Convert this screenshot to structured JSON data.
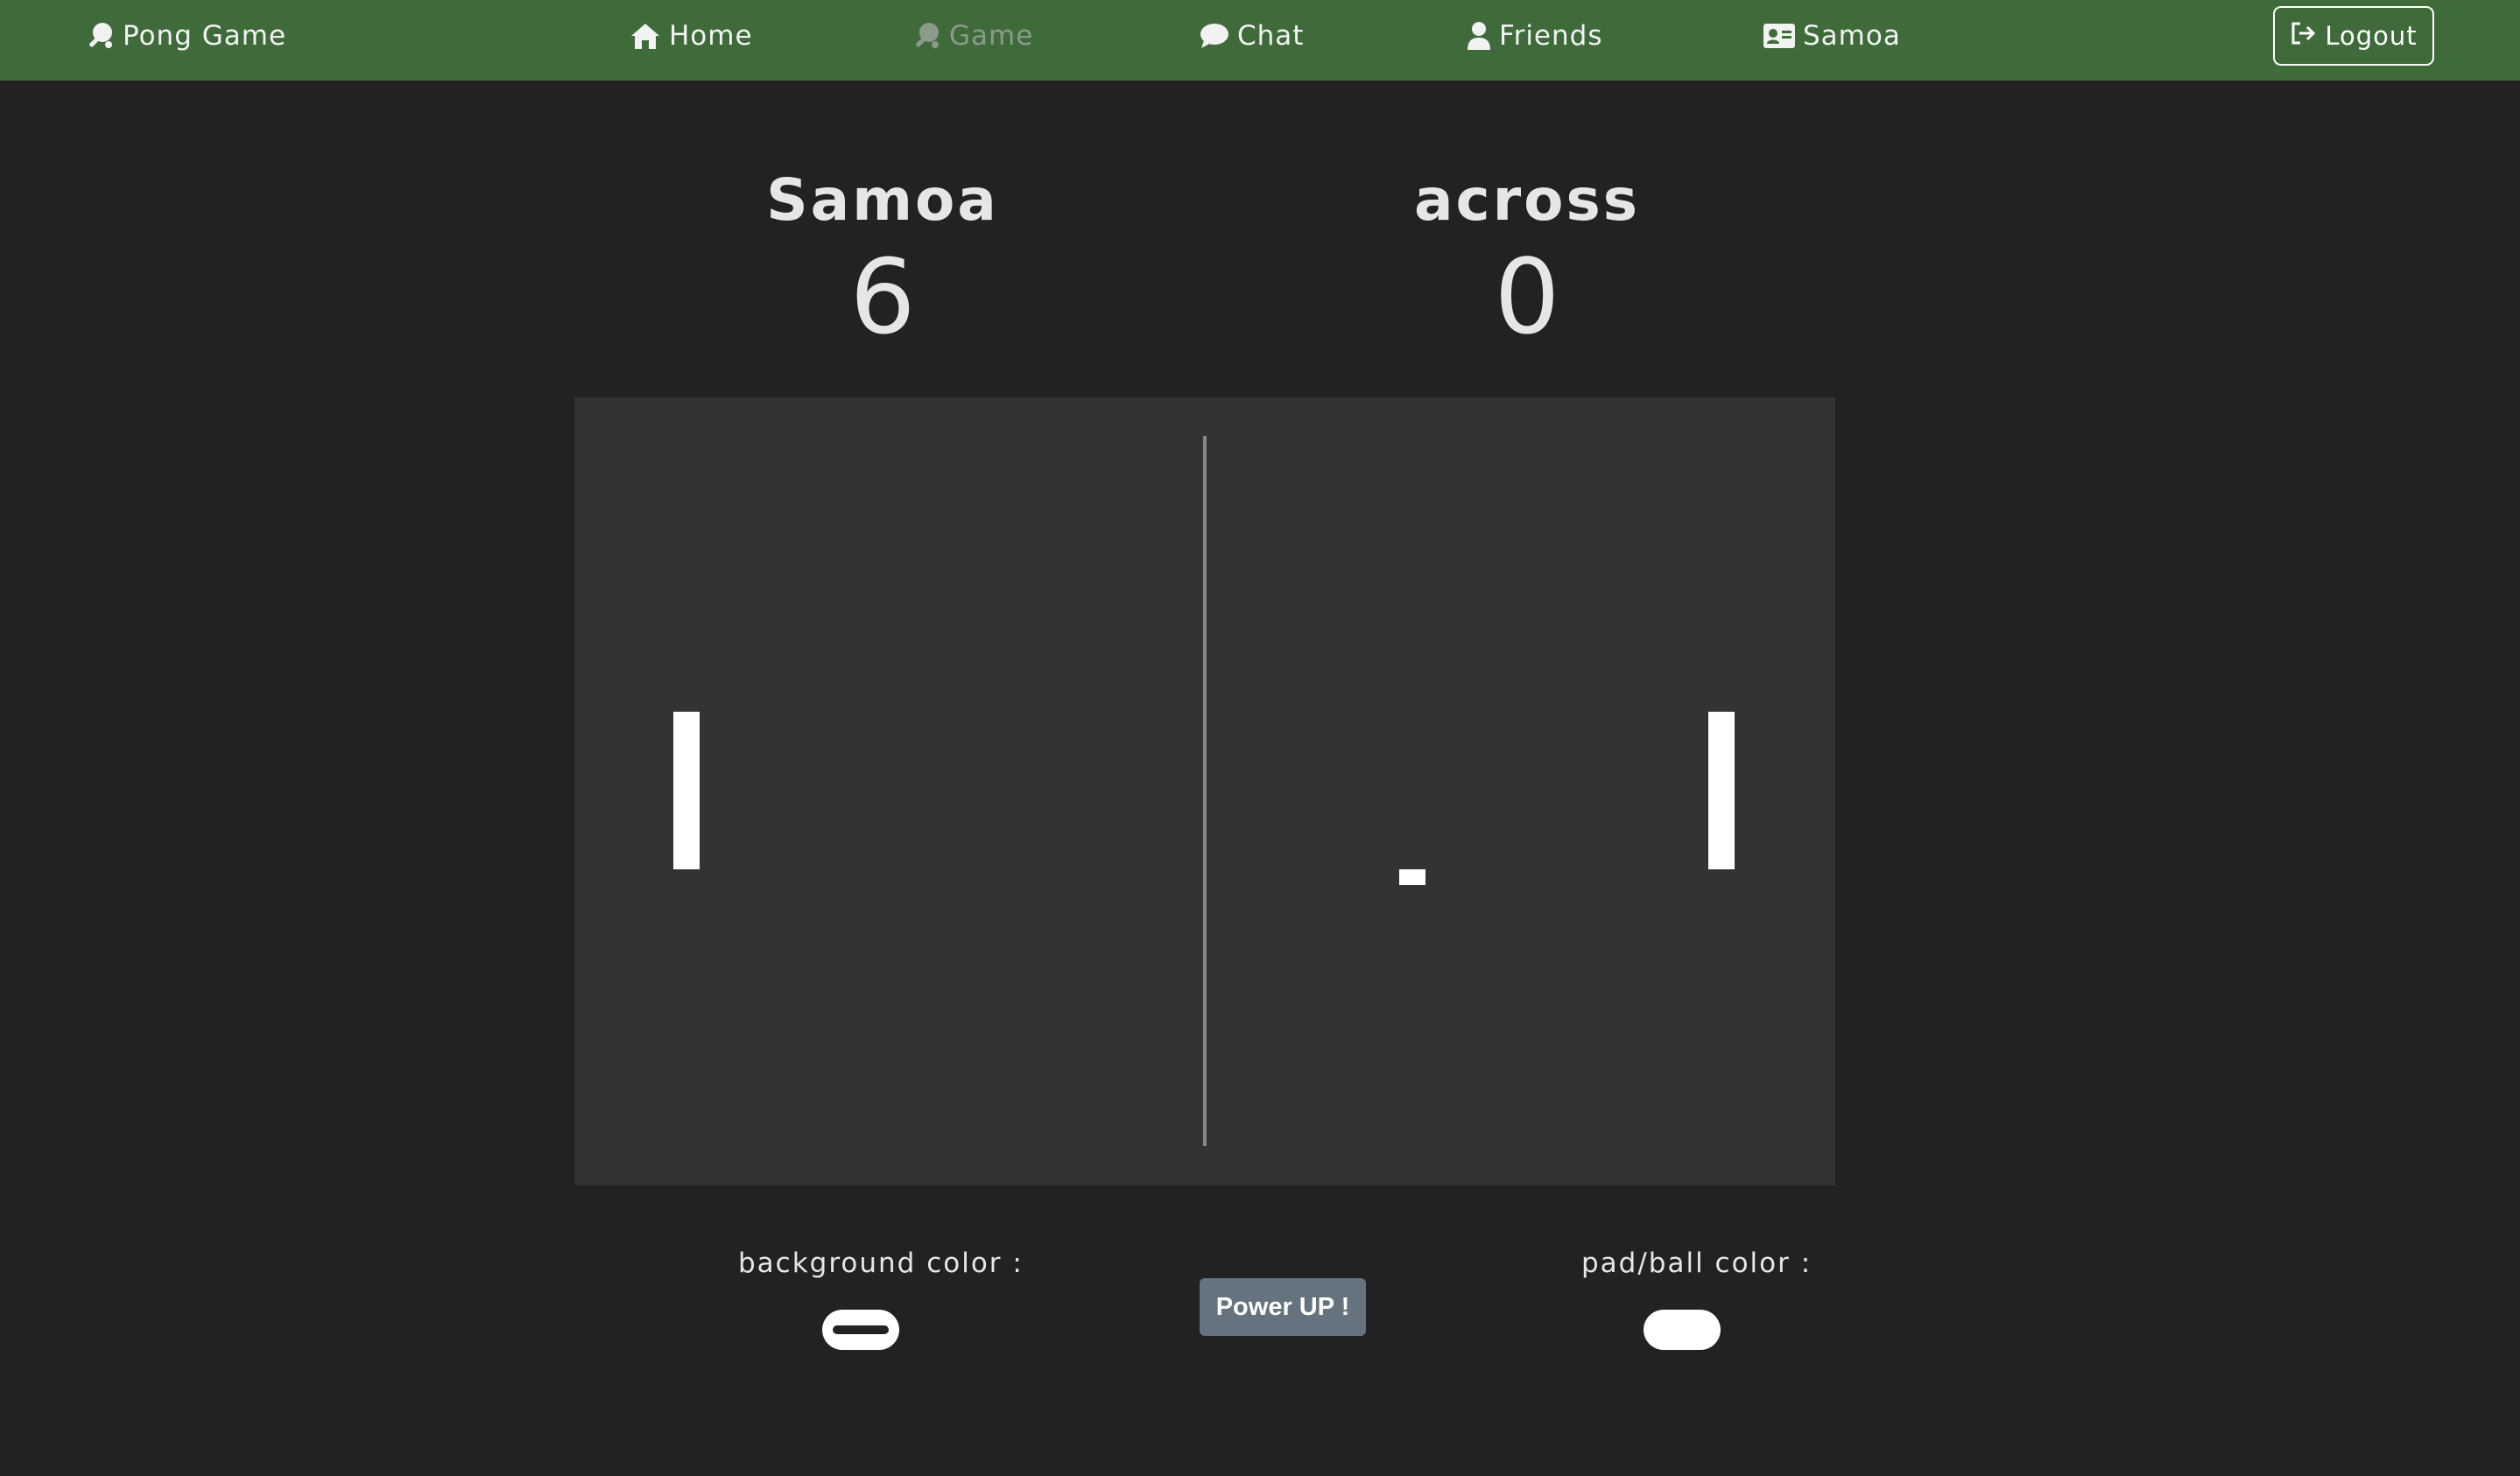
{
  "nav": {
    "brand": {
      "label": "Pong Game",
      "icon": "ping-pong-icon"
    },
    "items": [
      {
        "label": "Home",
        "icon": "home-icon",
        "active": false
      },
      {
        "label": "Game",
        "icon": "ping-pong-icon",
        "active": true
      },
      {
        "label": "Chat",
        "icon": "chat-bubble-icon",
        "active": false
      },
      {
        "label": "Friends",
        "icon": "user-icon",
        "active": false
      },
      {
        "label": "Samoa",
        "icon": "id-card-icon",
        "active": false
      }
    ],
    "logout": {
      "label": "Logout",
      "icon": "logout-icon"
    }
  },
  "scoreboard": {
    "player1": {
      "name": "Samoa",
      "score": "6"
    },
    "player2": {
      "name": "across",
      "score": "0"
    }
  },
  "controls": {
    "background_color_label": "background color :",
    "pad_ball_color_label": "pad/ball color :",
    "power_up_label": "Power UP !"
  },
  "colors": {
    "navbar": "#3f6b3b",
    "page_background": "#222222",
    "board_background": "#333333",
    "paddle_and_ball": "#ffffff",
    "center_line": "#888888",
    "power_up_button": "#65737e"
  }
}
